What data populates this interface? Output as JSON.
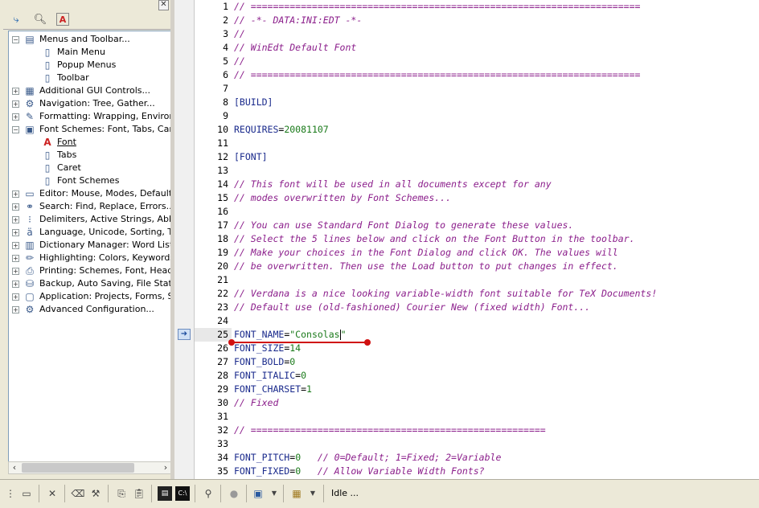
{
  "toolbar_icons": [
    "wrap-icon",
    "search-icon",
    "font-icon"
  ],
  "tree": [
    {
      "label": "Menus and Toolbar...",
      "level": 0,
      "expander": "minus",
      "icon": "menu-icon"
    },
    {
      "label": "Main Menu",
      "level": 1,
      "icon": "page-icon"
    },
    {
      "label": "Popup Menus",
      "level": 1,
      "icon": "page-icon"
    },
    {
      "label": "Toolbar",
      "level": 1,
      "icon": "page-icon"
    },
    {
      "label": "Additional GUI Controls...",
      "level": 0,
      "expander": "plus",
      "icon": "gui-icon"
    },
    {
      "label": "Navigation: Tree, Gather...",
      "level": 0,
      "expander": "plus",
      "icon": "gear-icon"
    },
    {
      "label": "Formatting: Wrapping, Environme",
      "level": 0,
      "expander": "plus",
      "icon": "pen-icon"
    },
    {
      "label": "Font Schemes: Font, Tabs, Caret",
      "level": 0,
      "expander": "minus",
      "icon": "font-scheme-icon"
    },
    {
      "label": "Font",
      "level": 1,
      "icon": "font-icon",
      "selected": true
    },
    {
      "label": "Tabs",
      "level": 1,
      "icon": "page-icon"
    },
    {
      "label": "Caret",
      "level": 1,
      "icon": "page-icon"
    },
    {
      "label": "Font Schemes",
      "level": 1,
      "icon": "page-icon"
    },
    {
      "label": "Editor: Mouse, Modes, Defaults..",
      "level": 0,
      "expander": "plus",
      "icon": "editor-icon"
    },
    {
      "label": "Search: Find, Replace, Errors...",
      "level": 0,
      "expander": "plus",
      "icon": "binoculars-icon"
    },
    {
      "label": "Delimiters, Active Strings, Abbrev",
      "level": 0,
      "expander": "plus",
      "icon": "delimiter-icon"
    },
    {
      "label": "Language, Unicode, Sorting, Tran",
      "level": 0,
      "expander": "plus",
      "icon": "language-icon"
    },
    {
      "label": "Dictionary Manager: Word Lists, S",
      "level": 0,
      "expander": "plus",
      "icon": "book-icon"
    },
    {
      "label": "Highlighting: Colors, Keywords...",
      "level": 0,
      "expander": "plus",
      "icon": "highlighter-icon"
    },
    {
      "label": "Printing: Schemes, Font, Headers",
      "level": 0,
      "expander": "plus",
      "icon": "printer-icon"
    },
    {
      "label": "Backup, Auto Saving, File Status.",
      "level": 0,
      "expander": "plus",
      "icon": "backup-icon"
    },
    {
      "label": "Application: Projects, Forms, Sou",
      "level": 0,
      "expander": "plus",
      "icon": "window-icon"
    },
    {
      "label": "Advanced Configuration...",
      "level": 0,
      "expander": "plus",
      "icon": "gears-icon"
    }
  ],
  "editor": {
    "current_line": 25,
    "lines": [
      {
        "n": "1",
        "parts": [
          {
            "t": "// ======================================================================",
            "c": "comment"
          }
        ]
      },
      {
        "n": "2",
        "parts": [
          {
            "t": "// -*- DATA:INI:EDT -*-",
            "c": "comment"
          }
        ]
      },
      {
        "n": "3",
        "parts": [
          {
            "t": "//",
            "c": "comment"
          }
        ]
      },
      {
        "n": "4",
        "parts": [
          {
            "t": "// WinEdt Default Font",
            "c": "comment"
          }
        ]
      },
      {
        "n": "5",
        "parts": [
          {
            "t": "//",
            "c": "comment"
          }
        ]
      },
      {
        "n": "6",
        "parts": [
          {
            "t": "// ======================================================================",
            "c": "comment"
          }
        ]
      },
      {
        "n": "7",
        "parts": []
      },
      {
        "n": "8",
        "parts": [
          {
            "t": "[BUILD]",
            "c": "section"
          }
        ]
      },
      {
        "n": "9",
        "parts": []
      },
      {
        "n": "10",
        "parts": [
          {
            "t": "REQUIRES",
            "c": "key"
          },
          {
            "t": "=",
            "c": "eq"
          },
          {
            "t": "20081107",
            "c": "val"
          }
        ]
      },
      {
        "n": "11",
        "parts": []
      },
      {
        "n": "12",
        "parts": [
          {
            "t": "[FONT]",
            "c": "section"
          }
        ]
      },
      {
        "n": "13",
        "parts": []
      },
      {
        "n": "14",
        "parts": [
          {
            "t": "// This font will be used in all documents except for any",
            "c": "comment"
          }
        ]
      },
      {
        "n": "15",
        "parts": [
          {
            "t": "// modes overwritten by Font Schemes...",
            "c": "comment"
          }
        ]
      },
      {
        "n": "16",
        "parts": []
      },
      {
        "n": "17",
        "parts": [
          {
            "t": "// You can use Standard Font Dialog to generate these values.",
            "c": "comment"
          }
        ]
      },
      {
        "n": "18",
        "parts": [
          {
            "t": "// Select the 5 lines below and click on the Font Button in the toolbar.",
            "c": "comment"
          }
        ]
      },
      {
        "n": "19",
        "parts": [
          {
            "t": "// Make your choices in the Font Dialog and click OK. The values will",
            "c": "comment"
          }
        ]
      },
      {
        "n": "20",
        "parts": [
          {
            "t": "// be overwritten. Then use the Load button to put changes in effect.",
            "c": "comment"
          }
        ]
      },
      {
        "n": "21",
        "parts": []
      },
      {
        "n": "22",
        "parts": [
          {
            "t": "// Verdana is a nice looking variable-width font suitable for TeX Documents!",
            "c": "comment"
          }
        ]
      },
      {
        "n": "23",
        "parts": [
          {
            "t": "// Default use (old-fashioned) Courier New (fixed width) Font...",
            "c": "comment"
          }
        ]
      },
      {
        "n": "24",
        "parts": []
      },
      {
        "n": "25",
        "parts": [
          {
            "t": "FONT_NAME",
            "c": "key"
          },
          {
            "t": "=",
            "c": "eq"
          },
          {
            "t": "\"Consolas",
            "c": "val"
          },
          {
            "t": "",
            "c": "caret"
          },
          {
            "t": "\"",
            "c": "val"
          }
        ]
      },
      {
        "n": "26",
        "parts": [
          {
            "t": "FONT_SIZE",
            "c": "key"
          },
          {
            "t": "=",
            "c": "eq"
          },
          {
            "t": "14",
            "c": "val"
          }
        ]
      },
      {
        "n": "27",
        "parts": [
          {
            "t": "FONT_BOLD",
            "c": "key"
          },
          {
            "t": "=",
            "c": "eq"
          },
          {
            "t": "0",
            "c": "val"
          }
        ]
      },
      {
        "n": "28",
        "parts": [
          {
            "t": "FONT_ITALIC",
            "c": "key"
          },
          {
            "t": "=",
            "c": "eq"
          },
          {
            "t": "0",
            "c": "val"
          }
        ]
      },
      {
        "n": "29",
        "parts": [
          {
            "t": "FONT_CHARSET",
            "c": "key"
          },
          {
            "t": "=",
            "c": "eq"
          },
          {
            "t": "1",
            "c": "val"
          }
        ]
      },
      {
        "n": "30",
        "parts": [
          {
            "t": "// Fixed",
            "c": "comment"
          }
        ]
      },
      {
        "n": "31",
        "parts": []
      },
      {
        "n": "32",
        "parts": [
          {
            "t": "// =====================================================",
            "c": "comment"
          }
        ]
      },
      {
        "n": "33",
        "parts": []
      },
      {
        "n": "34",
        "parts": [
          {
            "t": "FONT_PITCH",
            "c": "key"
          },
          {
            "t": "=",
            "c": "eq"
          },
          {
            "t": "0",
            "c": "val"
          },
          {
            "t": "   // 0=Default; 1=Fixed; 2=Variable",
            "c": "comment"
          }
        ]
      },
      {
        "n": "35",
        "parts": [
          {
            "t": "FONT_FIXED",
            "c": "key"
          },
          {
            "t": "=",
            "c": "eq"
          },
          {
            "t": "0",
            "c": "val"
          },
          {
            "t": "   // Allow Variable Width Fonts?",
            "c": "comment"
          }
        ]
      }
    ]
  },
  "statusbar": {
    "status": "Idle ..."
  }
}
